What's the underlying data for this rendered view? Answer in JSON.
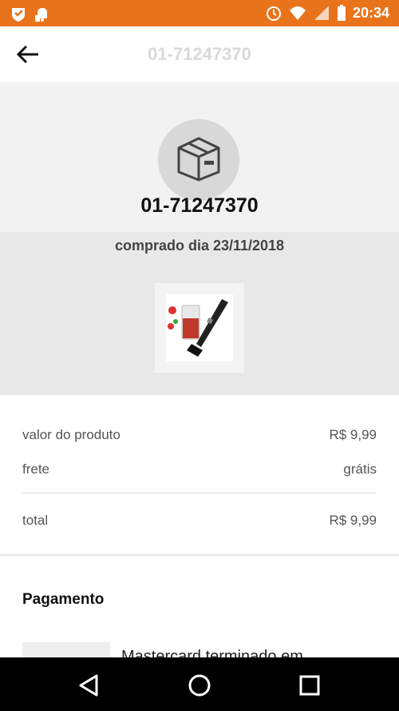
{
  "status_bar": {
    "time": "20:34",
    "icons_left": [
      "shield-heart-icon",
      "notification-icon"
    ],
    "icons_right": [
      "alarm-icon",
      "wifi-icon",
      "signal-icon",
      "battery-icon"
    ],
    "background": "#e8731a"
  },
  "app_bar": {
    "title": "01-71247370"
  },
  "order": {
    "number": "01-71247370",
    "purchased_text": "comprado dia 23/11/2018",
    "product_image": "hand-blender-product-image"
  },
  "summary": {
    "rows": [
      {
        "label": "valor do produto",
        "value": "R$ 9,99"
      },
      {
        "label": "frete",
        "value": "grátis"
      }
    ],
    "total": {
      "label": "total",
      "value": "R$ 9,99"
    }
  },
  "payment": {
    "title": "Pagamento",
    "text": "Mastercard terminado em"
  },
  "nav_bar": {
    "buttons": [
      "back-triangle-icon",
      "home-circle-icon",
      "recents-square-icon"
    ]
  }
}
